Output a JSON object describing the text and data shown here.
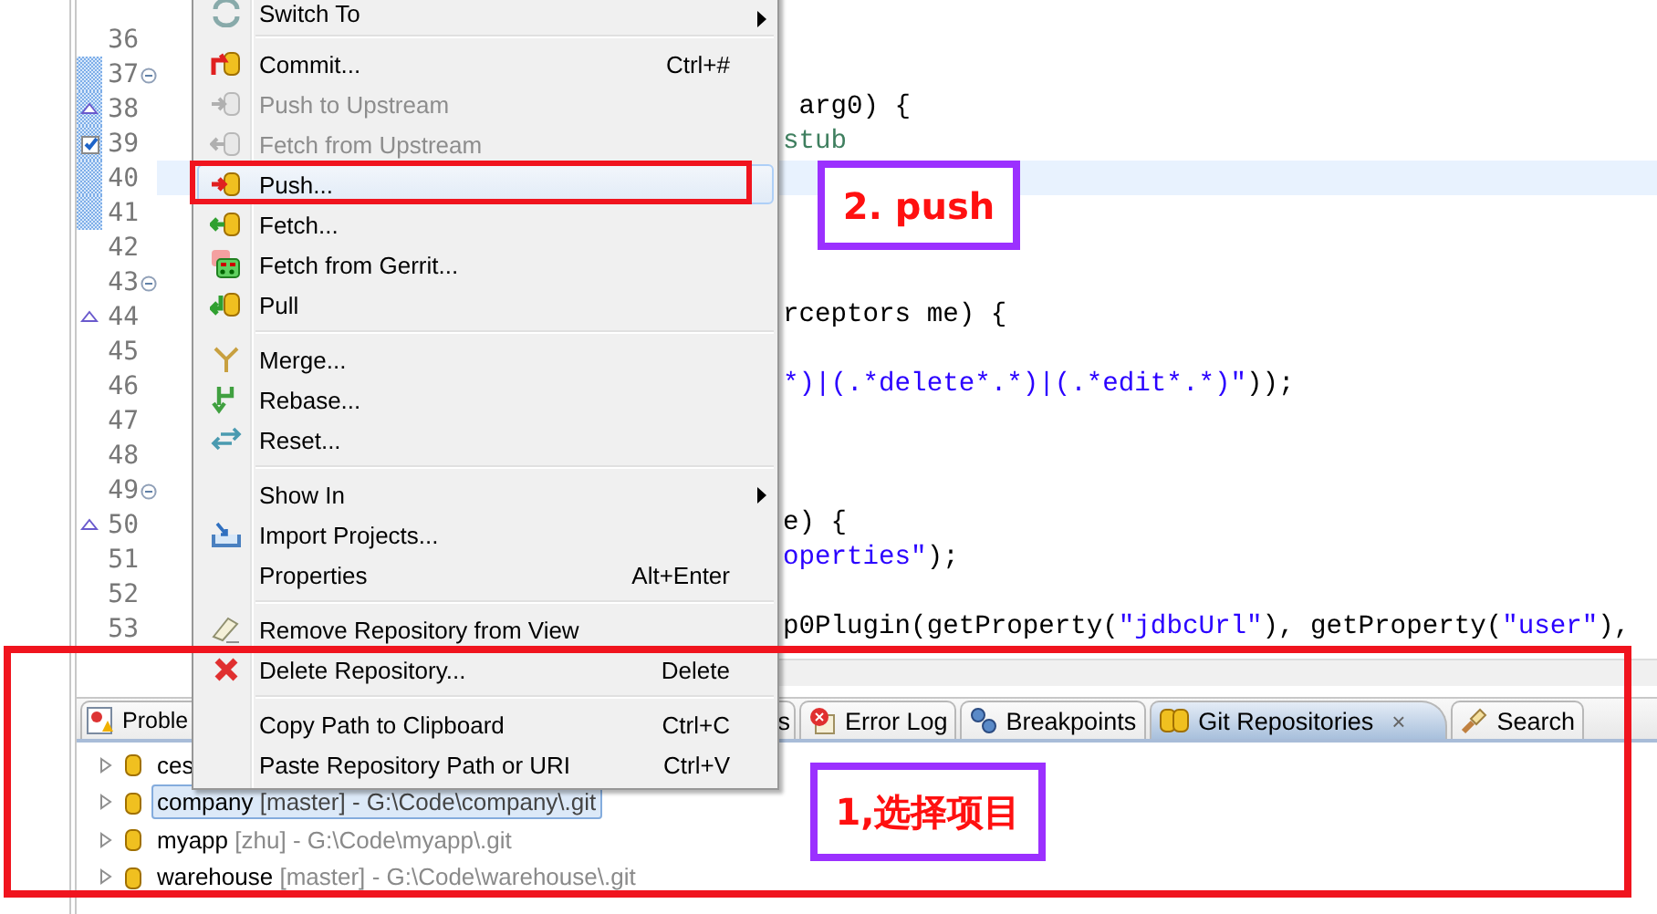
{
  "editor": {
    "lines": [
      {
        "number": "36",
        "kind": "plain",
        "fold": false,
        "changed": false,
        "current": false
      },
      {
        "number": "37",
        "kind": "plain",
        "fold": true,
        "changed": true,
        "current": false
      },
      {
        "number": "38",
        "kind": "override",
        "fold": false,
        "changed": true,
        "current": false,
        "code": [
          {
            "kind": "plain",
            "text": " arg0) {"
          }
        ]
      },
      {
        "number": "39",
        "kind": "task",
        "fold": false,
        "changed": true,
        "current": false,
        "code": [
          {
            "kind": "comment",
            "text": "stub"
          }
        ]
      },
      {
        "number": "40",
        "kind": "plain",
        "fold": false,
        "changed": true,
        "current": true
      },
      {
        "number": "41",
        "kind": "plain",
        "fold": false,
        "changed": true,
        "current": false
      },
      {
        "number": "42",
        "kind": "plain",
        "fold": false,
        "changed": false,
        "current": false
      },
      {
        "number": "43",
        "kind": "plain",
        "fold": true,
        "changed": false,
        "current": false
      },
      {
        "number": "44",
        "kind": "override",
        "fold": false,
        "changed": false,
        "current": false,
        "code": [
          {
            "kind": "plain",
            "text": "rceptors me) {"
          }
        ]
      },
      {
        "number": "45",
        "kind": "plain",
        "fold": false,
        "changed": false,
        "current": false
      },
      {
        "number": "46",
        "kind": "plain",
        "fold": false,
        "changed": false,
        "current": false,
        "code": [
          {
            "kind": "string",
            "text": "*)|(.*delete*.*)|(.*edit*.*)\""
          },
          {
            "kind": "plain",
            "text": "));"
          }
        ]
      },
      {
        "number": "47",
        "kind": "plain",
        "fold": false,
        "changed": false,
        "current": false
      },
      {
        "number": "48",
        "kind": "plain",
        "fold": false,
        "changed": false,
        "current": false
      },
      {
        "number": "49",
        "kind": "plain",
        "fold": true,
        "changed": false,
        "current": false
      },
      {
        "number": "50",
        "kind": "override",
        "fold": false,
        "changed": false,
        "current": false,
        "code": [
          {
            "kind": "plain",
            "text": "e) {"
          }
        ]
      },
      {
        "number": "51",
        "kind": "plain",
        "fold": false,
        "changed": false,
        "current": false,
        "code": [
          {
            "kind": "string",
            "text": "operties\""
          },
          {
            "kind": "plain",
            "text": ");"
          }
        ]
      },
      {
        "number": "52",
        "kind": "plain",
        "fold": false,
        "changed": false,
        "current": false
      },
      {
        "number": "53",
        "kind": "plain",
        "fold": false,
        "changed": false,
        "current": false,
        "code": [
          {
            "kind": "plain",
            "text": "p0Plugin(getProperty("
          },
          {
            "kind": "string",
            "text": "\"jdbcUrl\""
          },
          {
            "kind": "plain",
            "text": "), getProperty("
          },
          {
            "kind": "string",
            "text": "\"user\""
          },
          {
            "kind": "plain",
            "text": "),"
          }
        ]
      }
    ]
  },
  "panel": {
    "tabs": [
      {
        "label": "Proble",
        "selected": false
      },
      {
        "label": "s",
        "selected": false
      },
      {
        "label": "Error Log",
        "selected": false
      },
      {
        "label": "Breakpoints",
        "selected": false
      },
      {
        "label": "Git Repositories",
        "selected": true,
        "close": "×"
      },
      {
        "label": "Search",
        "selected": false
      }
    ],
    "repositories": [
      {
        "name": "ces",
        "selected": false
      },
      {
        "name": "company",
        "branch": "[master]",
        "path": "- G:\\Code\\company\\.git",
        "selected": true
      },
      {
        "name": "myapp",
        "branch": "[zhu]",
        "path": "- G:\\Code\\myapp\\.git",
        "selected": false
      },
      {
        "name": "warehouse",
        "branch": "[master]",
        "path": "- G:\\Code\\warehouse\\.git",
        "selected": false
      }
    ]
  },
  "context_menu": {
    "items": [
      {
        "kind": "item",
        "label": "Switch To",
        "submenu": true,
        "disabled": false,
        "selected": false
      },
      {
        "kind": "separator"
      },
      {
        "kind": "item",
        "label": "Commit...",
        "shortcut": "Ctrl+#",
        "submenu": false,
        "disabled": false,
        "selected": false
      },
      {
        "kind": "item",
        "label": "Push to Upstream",
        "submenu": false,
        "disabled": true,
        "selected": false
      },
      {
        "kind": "item",
        "label": "Fetch from Upstream",
        "submenu": false,
        "disabled": true,
        "selected": false
      },
      {
        "kind": "item",
        "label": "Push...",
        "submenu": false,
        "disabled": false,
        "selected": true
      },
      {
        "kind": "item",
        "label": "Fetch...",
        "submenu": false,
        "disabled": false,
        "selected": false
      },
      {
        "kind": "item",
        "label": "Fetch from Gerrit...",
        "submenu": false,
        "disabled": false,
        "selected": false
      },
      {
        "kind": "item",
        "label": "Pull",
        "submenu": false,
        "disabled": false,
        "selected": false
      },
      {
        "kind": "separator"
      },
      {
        "kind": "item",
        "label": "Merge...",
        "submenu": false,
        "disabled": false,
        "selected": false
      },
      {
        "kind": "item",
        "label": "Rebase...",
        "submenu": false,
        "disabled": false,
        "selected": false
      },
      {
        "kind": "item",
        "label": "Reset...",
        "submenu": false,
        "disabled": false,
        "selected": false
      },
      {
        "kind": "separator"
      },
      {
        "kind": "item",
        "label": "Show In",
        "submenu": true,
        "disabled": false,
        "selected": false
      },
      {
        "kind": "item",
        "label": "Import Projects...",
        "submenu": false,
        "disabled": false,
        "selected": false
      },
      {
        "kind": "item",
        "label": "Properties",
        "shortcut": "Alt+Enter",
        "submenu": false,
        "disabled": false,
        "selected": false
      },
      {
        "kind": "separator"
      },
      {
        "kind": "item",
        "label": "Remove Repository from View",
        "submenu": false,
        "disabled": false,
        "selected": false
      },
      {
        "kind": "item",
        "label": "Delete Repository...",
        "shortcut": "Delete",
        "submenu": false,
        "disabled": false,
        "selected": false
      },
      {
        "kind": "separator"
      },
      {
        "kind": "item",
        "label": "Copy Path to Clipboard",
        "shortcut": "Ctrl+C",
        "submenu": false,
        "disabled": false,
        "selected": false
      },
      {
        "kind": "item",
        "label": "Paste Repository Path or URI",
        "shortcut": "Ctrl+V",
        "submenu": false,
        "disabled": false,
        "selected": false
      }
    ]
  },
  "annotations": [
    {
      "kind": "highlight"
    },
    {
      "kind": "callout",
      "text": "2. push"
    },
    {
      "kind": "highlight"
    },
    {
      "kind": "callout",
      "text": "1,选择项目"
    }
  ]
}
